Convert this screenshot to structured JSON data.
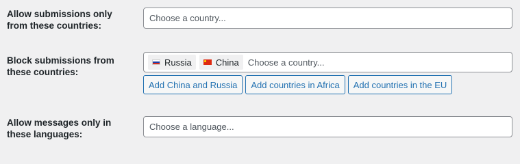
{
  "rows": {
    "allow_countries": {
      "label": "Allow submissions only from these countries:",
      "placeholder": "Choose a country..."
    },
    "block_countries": {
      "label": "Block submissions from these countries:",
      "chips": [
        {
          "label": "Russia",
          "flag_icon": "russia-flag-icon"
        },
        {
          "label": "China",
          "flag_icon": "china-flag-icon"
        }
      ],
      "placeholder": "Choose a country...",
      "buttons": [
        {
          "label": "Add China and Russia"
        },
        {
          "label": "Add countries in Africa"
        },
        {
          "label": "Add countries in the EU"
        }
      ]
    },
    "allow_languages": {
      "label": "Allow messages only in these languages:",
      "placeholder": "Choose a language..."
    }
  },
  "colors": {
    "page_background": "#f0f0f1",
    "field_border": "#8c8f94",
    "button_accent": "#2271b1",
    "chip_background": "#f0f0f1"
  }
}
